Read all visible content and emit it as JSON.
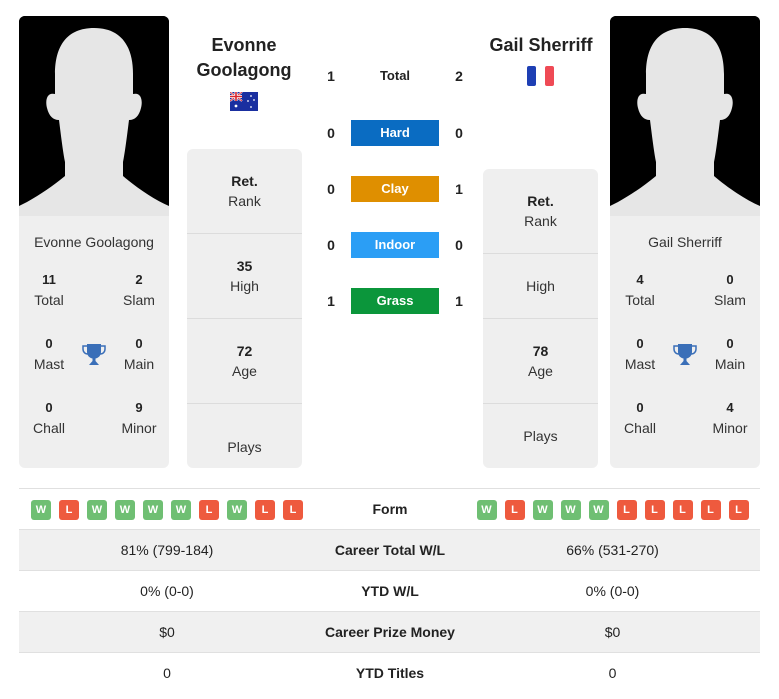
{
  "player1": {
    "name_line1": "Evonne",
    "name_line2": "Goolagong",
    "card_name": "Evonne Goolagong",
    "flag": "australia-flag",
    "rank": {
      "value": "Ret.",
      "label": "Rank"
    },
    "high": {
      "value": "35",
      "label": "High"
    },
    "age": {
      "value": "72",
      "label": "Age"
    },
    "plays": {
      "value": "",
      "label": "Plays"
    },
    "titles": {
      "total": {
        "value": "11",
        "label": "Total"
      },
      "slam": {
        "value": "2",
        "label": "Slam"
      },
      "mast": {
        "value": "0",
        "label": "Mast"
      },
      "main": {
        "value": "0",
        "label": "Main"
      },
      "chall": {
        "value": "0",
        "label": "Chall"
      },
      "minor": {
        "value": "9",
        "label": "Minor"
      }
    },
    "form": [
      "W",
      "L",
      "W",
      "W",
      "W",
      "W",
      "L",
      "W",
      "L",
      "L"
    ]
  },
  "player2": {
    "name": "Gail Sherriff",
    "card_name": "Gail Sherriff",
    "flag": "france-flag",
    "rank": {
      "value": "Ret.",
      "label": "Rank"
    },
    "high": {
      "value": "",
      "label": "High"
    },
    "age": {
      "value": "78",
      "label": "Age"
    },
    "plays": {
      "value": "",
      "label": "Plays"
    },
    "titles": {
      "total": {
        "value": "4",
        "label": "Total"
      },
      "slam": {
        "value": "0",
        "label": "Slam"
      },
      "mast": {
        "value": "0",
        "label": "Mast"
      },
      "main": {
        "value": "0",
        "label": "Main"
      },
      "chall": {
        "value": "0",
        "label": "Chall"
      },
      "minor": {
        "value": "4",
        "label": "Minor"
      }
    },
    "form": [
      "W",
      "L",
      "W",
      "W",
      "W",
      "L",
      "L",
      "L",
      "L",
      "L"
    ]
  },
  "h2h": {
    "total": {
      "label": "Total",
      "p1": "1",
      "p2": "2"
    },
    "surfaces": [
      {
        "label": "Hard",
        "p1": "0",
        "p2": "0",
        "color": "#0a6cc2"
      },
      {
        "label": "Clay",
        "p1": "0",
        "p2": "1",
        "color": "#df8f00"
      },
      {
        "label": "Indoor",
        "p1": "0",
        "p2": "0",
        "color": "#2b9ef5"
      },
      {
        "label": "Grass",
        "p1": "1",
        "p2": "1",
        "color": "#0b963b"
      }
    ]
  },
  "stats": {
    "form_label": "Form",
    "rows": [
      {
        "label": "Career Total W/L",
        "p1": "81% (799-184)",
        "p2": "66% (531-270)"
      },
      {
        "label": "YTD W/L",
        "p1": "0% (0-0)",
        "p2": "0% (0-0)"
      },
      {
        "label": "Career Prize Money",
        "p1": "$0",
        "p2": "$0"
      },
      {
        "label": "YTD Titles",
        "p1": "0",
        "p2": "0"
      }
    ]
  },
  "colors": {
    "win": "#6fbf73",
    "loss": "#ee5a3e",
    "trophy": "#3a6fb8"
  }
}
